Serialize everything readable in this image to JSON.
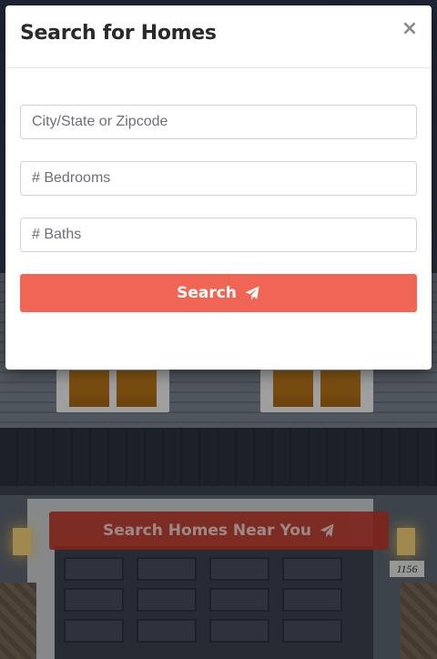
{
  "modal": {
    "title": "Search for Homes",
    "close_label": "×",
    "fields": {
      "location_placeholder": "City/State or Zipcode",
      "bedrooms_placeholder": "# Bedrooms",
      "baths_placeholder": "# Baths"
    },
    "search_label": "Search",
    "search_icon": "paper-plane-icon",
    "accent_color": "#f06553"
  },
  "background": {
    "near_you_label": "Search Homes Near You",
    "near_you_icon": "paper-plane-icon",
    "house_number": "1156"
  }
}
